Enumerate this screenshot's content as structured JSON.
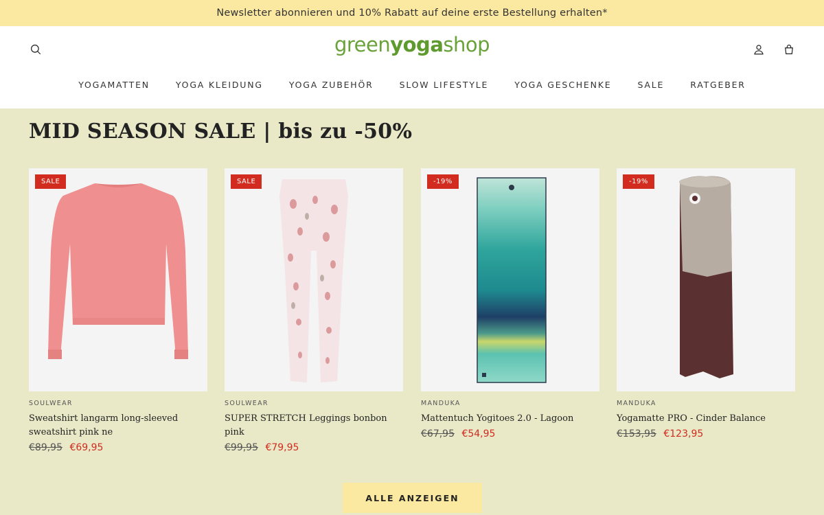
{
  "announcement": "Newsletter abonnieren und 10% Rabatt auf deine erste Bestellung erhalten*",
  "logo": {
    "part1": "green",
    "part2": "yoga",
    "part3": "shop"
  },
  "icons": {
    "search": "search-icon",
    "account": "user-icon",
    "cart": "bag-icon"
  },
  "nav": [
    {
      "label": "YOGAMATTEN"
    },
    {
      "label": "YOGA KLEIDUNG"
    },
    {
      "label": "YOGA ZUBEHÖR"
    },
    {
      "label": "SLOW LIFESTYLE"
    },
    {
      "label": "YOGA GESCHENKE"
    },
    {
      "label": "SALE"
    },
    {
      "label": "RATGEBER"
    }
  ],
  "section_title": "MID SEASON SALE | bis zu -50%",
  "products": [
    {
      "badge": "SALE",
      "brand": "SOULWEAR",
      "name": "Sweatshirt langarm long-sleeved sweatshirt pink ne",
      "old_price": "€89,95",
      "new_price": "€69,95"
    },
    {
      "badge": "SALE",
      "brand": "SOULWEAR",
      "name": "SUPER STRETCH Leggings bonbon pink",
      "old_price": "€99,95",
      "new_price": "€79,95"
    },
    {
      "badge": "-19%",
      "brand": "MANDUKA",
      "name": "Mattentuch Yogitoes 2.0 - Lagoon",
      "old_price": "€67,95",
      "new_price": "€54,95"
    },
    {
      "badge": "-19%",
      "brand": "MANDUKA",
      "name": "Yogamatte PRO - Cinder Balance",
      "old_price": "€153,95",
      "new_price": "€123,95"
    }
  ],
  "view_all": "ALLE ANZEIGEN",
  "colors": {
    "announcement_bg": "#fbe9a2",
    "page_bg": "#e9e8c7",
    "sale_red": "#d12c1f",
    "logo_green": "#6aa23a"
  }
}
